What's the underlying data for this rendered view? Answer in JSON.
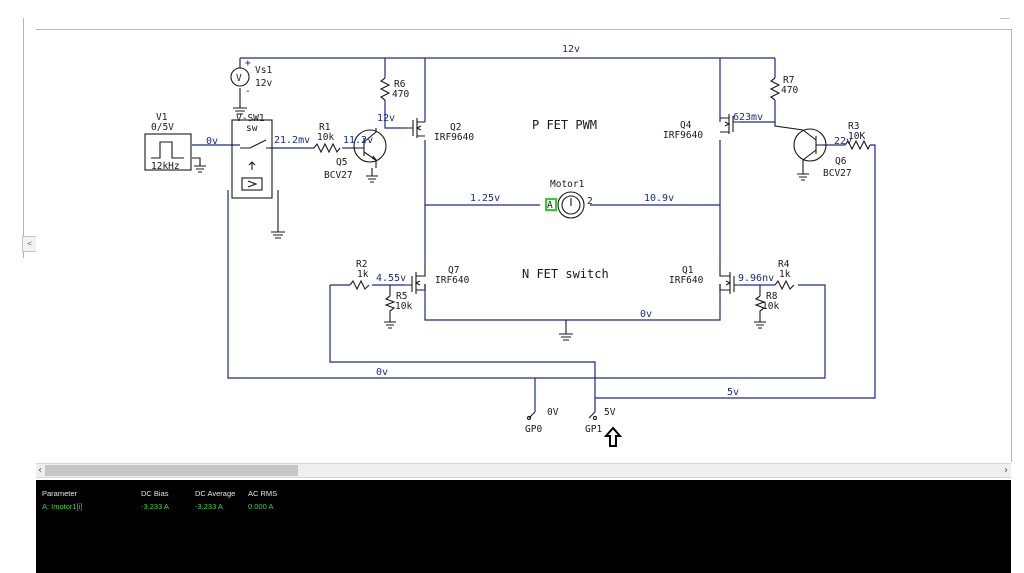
{
  "schematic": {
    "labels": {
      "v1_name": "V1",
      "v1_value": "0/5V",
      "v1_freq": "12kHz",
      "vs1_name": "Vs1",
      "vs1_value": "12v",
      "sw1_name": "V-SW1",
      "sw1_type": "sw",
      "r1_name": "R1",
      "r1_value": "10k",
      "r6_name": "R6",
      "r6_value": "470",
      "r7_name": "R7",
      "r7_value": "470",
      "r3_name": "R3",
      "r3_value": "10K",
      "q5_name": "Q5",
      "q5_type": "BCV27",
      "q6_name": "Q6",
      "q6_type": "BCV27",
      "q2_name": "Q2",
      "q2_type": "IRF9640",
      "q4_name": "Q4",
      "q4_type": "IRF9640",
      "q7_name": "Q7",
      "q7_type": "IRF640",
      "q1_name": "Q1",
      "q1_type": "IRF640",
      "r2_name": "R2",
      "r2_value": "1k",
      "r5_name": "R5",
      "r5_value": "10k",
      "r4_name": "R4",
      "r4_value": "1k",
      "r8_name": "R8",
      "r8_value": "10k",
      "motor_name": "Motor1",
      "pfet_title": "P FET PWM",
      "nfet_title": "N FET switch",
      "gp0_name": "GP0",
      "gp0_value": "0V",
      "gp1_name": "GP1",
      "gp1_value": "5V",
      "motor_pin_a": "A",
      "motor_pin_2": "2"
    },
    "voltages": {
      "rail_12v": "12v",
      "v1_out": "0v",
      "sw_out": "21.2mv",
      "q5_base": "11.2v",
      "q2_gate": "12v",
      "q4_gate": "623mv",
      "q6_base": "22v",
      "motor_left": "1.25v",
      "motor_right": "10.9v",
      "q7_gate": "4.55v",
      "q1_gate": "9.96nv",
      "ground_bus": "0v",
      "gp0_line": "0v",
      "gp1_line": "5v"
    }
  },
  "scrollbar": {
    "left_arrow": "‹",
    "right_arrow": "›"
  },
  "results": {
    "headers": [
      "Parameter",
      "DC Bias",
      "DC Average",
      "AC RMS"
    ],
    "row": [
      "A: Imotor1[i]",
      "-3.233 A",
      "-3.233 A",
      "0.000 A"
    ]
  },
  "colors": {
    "wire": "#1b2a8c",
    "component": "#1a1a1a",
    "result_value": "#39d639",
    "panel_bg": "#000000"
  }
}
